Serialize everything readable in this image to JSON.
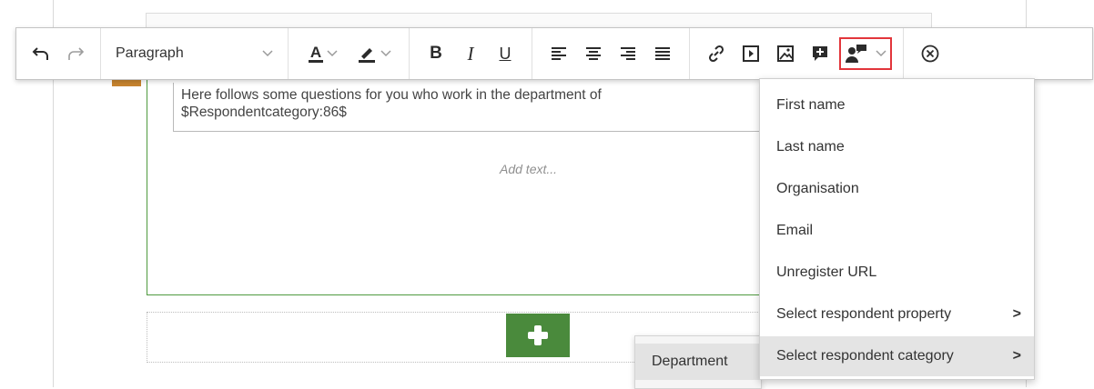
{
  "toolbar": {
    "paragraph_label": "Paragraph",
    "bold_label": "B",
    "italic_label": "I",
    "underline_label": "U",
    "text_color_label": "A",
    "icons": [
      "undo-icon",
      "redo-icon",
      "chevron-down-icon",
      "text-color-icon",
      "highlight-icon",
      "bold-icon",
      "italic-icon",
      "underline-icon",
      "align-left-icon",
      "align-center-icon",
      "align-right-icon",
      "align-justify-icon",
      "link-icon",
      "video-icon",
      "image-icon",
      "add-comment-icon",
      "personalize-icon",
      "close-circle-icon"
    ],
    "highlighted_button_color": "#e2353b"
  },
  "editor": {
    "question_text_line1": "Here follows some questions for you who work in the department of",
    "question_text_line2": "$Respondentcategory:86$",
    "add_text_placeholder": "Add text...",
    "accent_border": "#4f9a3f",
    "add_button_color": "#4a8a3c"
  },
  "dropdown": {
    "items": [
      {
        "label": "First name"
      },
      {
        "label": "Last name"
      },
      {
        "label": "Organisation"
      },
      {
        "label": "Email"
      },
      {
        "label": "Unregister URL"
      },
      {
        "label": "Select respondent property",
        "arrow": ">"
      },
      {
        "label": "Select respondent category",
        "arrow": ">"
      }
    ]
  },
  "submenu": {
    "items": [
      {
        "label": "Department"
      }
    ]
  }
}
